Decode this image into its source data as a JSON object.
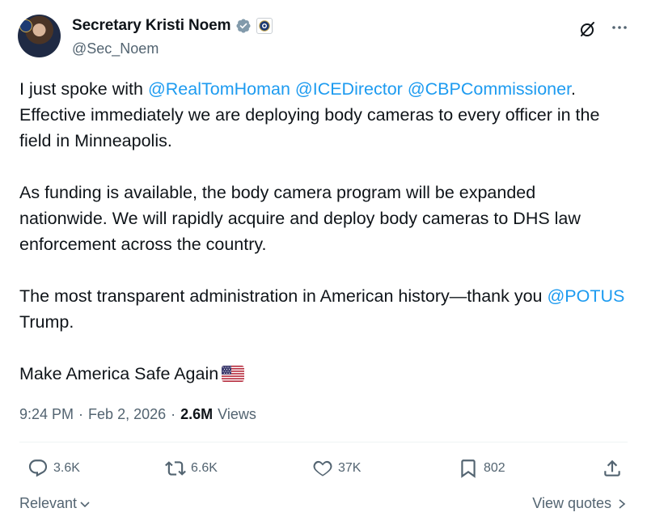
{
  "author": {
    "display_name": "Secretary Kristi Noem",
    "handle": "@Sec_Noem",
    "verified": true,
    "badge_icon": "dhs-seal-icon"
  },
  "tweet": {
    "p1": {
      "a": "I just spoke with ",
      "m1": "@RealTomHoman",
      "sp1": " ",
      "m2": "@ICEDirector",
      "sp2": " ",
      "m3": "@CBPCommissioner",
      "b": ". Effective immediately we are deploying body cameras to every officer in the field in Minneapolis."
    },
    "p2": "As funding is available, the body camera program will be expanded nationwide. We will rapidly acquire and deploy body cameras to DHS law enforcement across the country.",
    "p3": {
      "a": "The most transparent administration in American history—thank you ",
      "m1": "@POTUS",
      "b": " Trump."
    },
    "p4": "Make America Safe Again",
    "flag_icon": "us-flag-icon"
  },
  "meta": {
    "time": "9:24 PM",
    "sep1": "·",
    "date": "Feb 2, 2026",
    "sep2": "·",
    "views_count": "2.6M",
    "views_label": "Views"
  },
  "actions": {
    "replies": "3.6K",
    "reposts": "6.6K",
    "likes": "37K",
    "bookmarks": "802"
  },
  "footer": {
    "sort_label": "Relevant",
    "view_quotes": "View quotes"
  },
  "colors": {
    "link": "#1d9bf0",
    "text": "#0f1419",
    "muted": "#536471"
  }
}
